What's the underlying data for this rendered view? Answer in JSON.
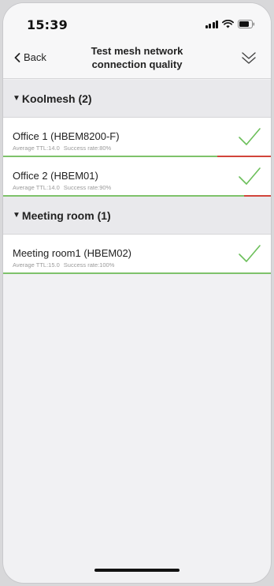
{
  "status_bar": {
    "time": "15:39"
  },
  "nav": {
    "back_label": "Back",
    "title_line1": "Test mesh network",
    "title_line2": "connection quality"
  },
  "groups": [
    {
      "header": "Koolmesh (2)",
      "items": [
        {
          "name": "Office 1 (HBEM8200-F)",
          "ttl": "Average TTL:14.0",
          "success": "Success rate:80%",
          "success_rate": 0.8
        },
        {
          "name": "Office 2 (HBEM01)",
          "ttl": "Average TTL:14.0",
          "success": "Success rate:90%",
          "success_rate": 0.9
        }
      ]
    },
    {
      "header": "Meeting room (1)",
      "items": [
        {
          "name": "Meeting room1 (HBEM02)",
          "ttl": "Average TTL:15.0",
          "success": "Success rate:100%",
          "success_rate": 1.0
        }
      ]
    }
  ],
  "colors": {
    "good": "#7ec26b",
    "bad": "#d2453b",
    "check": "#6cbf5a"
  }
}
